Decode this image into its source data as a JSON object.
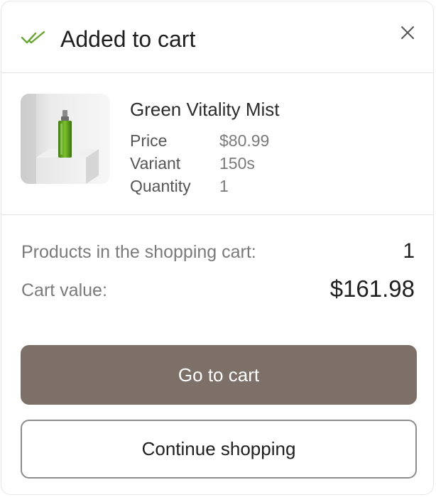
{
  "header": {
    "title": "Added to cart",
    "check_icon": "double-check-icon",
    "close_icon": "close-icon",
    "accent_color": "#6aa534"
  },
  "product": {
    "name": "Green Vitality Mist",
    "image_icon": "product-bottle-image",
    "attributes": [
      {
        "label": "Price",
        "value": "$80.99"
      },
      {
        "label": "Variant",
        "value": "150s"
      },
      {
        "label": "Quantity",
        "value": "1"
      }
    ]
  },
  "summary": {
    "products_count_label": "Products in the shopping cart:",
    "products_count_value": "1",
    "cart_value_label": "Cart value:",
    "cart_value": "$161.98"
  },
  "actions": {
    "go_to_cart_label": "Go to cart",
    "continue_shopping_label": "Continue shopping",
    "primary_color": "#7d7068"
  }
}
